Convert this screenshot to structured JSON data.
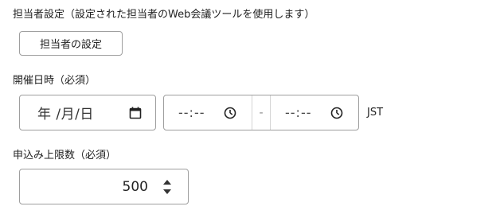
{
  "host_setting": {
    "label": "担当者設定（設定された担当者のWeb会議ツールを使用します）",
    "button_label": "担当者の設定"
  },
  "datetime": {
    "label": "開催日時（必須）",
    "date_placeholder": "年 /月/日",
    "start_time_placeholder": "--:--",
    "separator": "-",
    "end_time_placeholder": "--:--",
    "timezone": "JST"
  },
  "capacity": {
    "label": "申込み上限数（必須）",
    "value": "500"
  },
  "icons": {
    "calendar": "calendar-icon",
    "clock": "clock-icon",
    "spinner": "number-spinner-icon"
  }
}
